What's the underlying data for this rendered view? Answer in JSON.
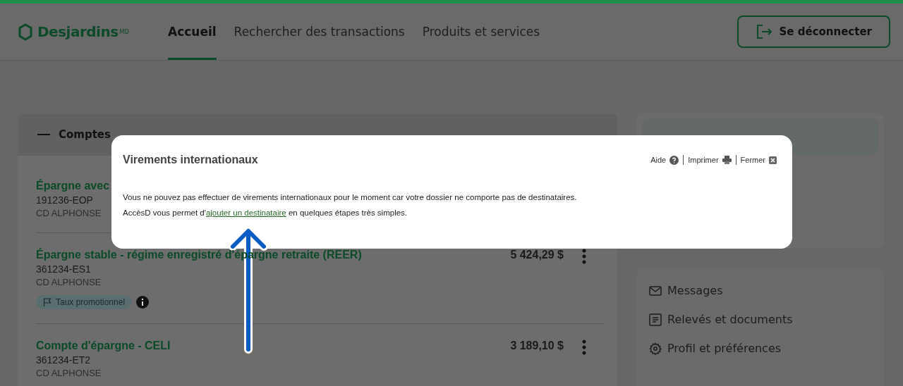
{
  "header": {
    "logo": "Desjardins",
    "logo_mark": "MD",
    "nav": [
      {
        "label": "Accueil",
        "selected": true
      },
      {
        "label": "Rechercher des transactions",
        "selected": false
      },
      {
        "label": "Produits et services",
        "selected": false
      }
    ],
    "logout": "Se déconnecter"
  },
  "accounts": {
    "title": "Comptes",
    "expanded": true,
    "items": [
      {
        "name": "Épargne avec",
        "number": "191236-EOP",
        "owner": "CD ALPHONSE"
      },
      {
        "name": "Épargne stable - régime enregistré d'épargne retraite (REER)",
        "number": "361234-ES1",
        "owner": "CD ALPHONSE",
        "amount": "5 424,29 $",
        "tag": "Taux promotionnel"
      },
      {
        "name": "Compte d'épargne - CELI",
        "number": "361234-ET2",
        "owner": "CD ALPHONSE",
        "amount": "3 189,10 $"
      }
    ]
  },
  "links": [
    {
      "label": "Messages",
      "kind": "mail"
    },
    {
      "label": "Relevés et documents",
      "kind": "doc"
    },
    {
      "label": "Profil et préférences",
      "kind": "gear"
    }
  ],
  "dialog": {
    "title": "Virements internationaux",
    "actions": [
      {
        "label": "Aide",
        "kind": "help"
      },
      {
        "label": "Imprimer",
        "kind": "print"
      },
      {
        "label": "Fermer",
        "kind": "close"
      }
    ],
    "message": "Vous ne pouvez pas effectuer de virements internationaux pour le moment car votre dossier ne comporte pas de destinataires.",
    "line2_before": "AccèsD vous permet d'",
    "link": "ajouter un destinataire",
    "line2_after": " en quelques étapes très simples."
  }
}
